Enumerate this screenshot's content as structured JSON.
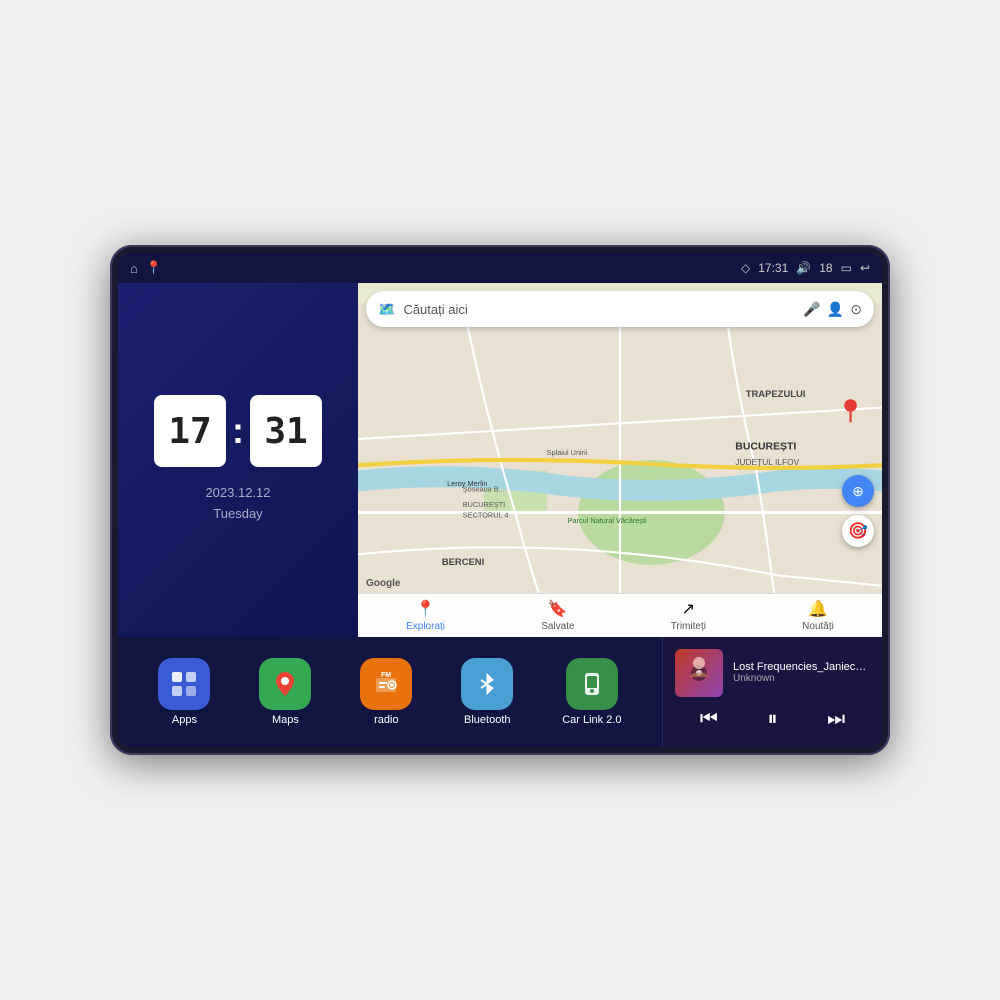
{
  "device": {
    "screen": {
      "status_bar": {
        "left_icons": [
          "home",
          "maps"
        ],
        "time": "17:31",
        "volume": "18",
        "battery": "▭",
        "back": "↩"
      },
      "clock_panel": {
        "hour": "17",
        "minute": "31",
        "date": "2023.12.12",
        "day": "Tuesday"
      },
      "map_panel": {
        "search_placeholder": "Căutați aici",
        "labels": {
          "trapezului": "TRAPEZULUI",
          "bucuresti": "BUCUREȘTI",
          "judet": "JUDEȚUL ILFOV",
          "berceni": "BERCENI",
          "leroy": "Leroy Merlin",
          "parcul": "Parcul Natural Văcărești",
          "sector4": "BUCUREȘTI SECTORUL 4",
          "splaiul": "Splaiul Unirii",
          "soseau": "Șoseaua B..."
        },
        "nav_items": [
          {
            "icon": "📍",
            "label": "Explorați",
            "active": true
          },
          {
            "icon": "🔖",
            "label": "Salvate",
            "active": false
          },
          {
            "icon": "↗",
            "label": "Trimiteți",
            "active": false
          },
          {
            "icon": "🔔",
            "label": "Noutăți",
            "active": false
          }
        ]
      },
      "apps": [
        {
          "label": "Apps",
          "icon": "⊞",
          "bg": "#3a5bd4"
        },
        {
          "label": "Maps",
          "icon": "📍",
          "bg": "#34a853"
        },
        {
          "label": "radio",
          "icon": "📻",
          "bg": "#e8720c"
        },
        {
          "label": "Bluetooth",
          "icon": "🔷",
          "bg": "#4a9fd4"
        },
        {
          "label": "Car Link 2.0",
          "icon": "📱",
          "bg": "#3a8f4a"
        }
      ],
      "music": {
        "title": "Lost Frequencies_Janieck Devy-...",
        "artist": "Unknown",
        "controls": {
          "prev": "⏮",
          "play": "⏸",
          "next": "⏭"
        }
      }
    }
  }
}
